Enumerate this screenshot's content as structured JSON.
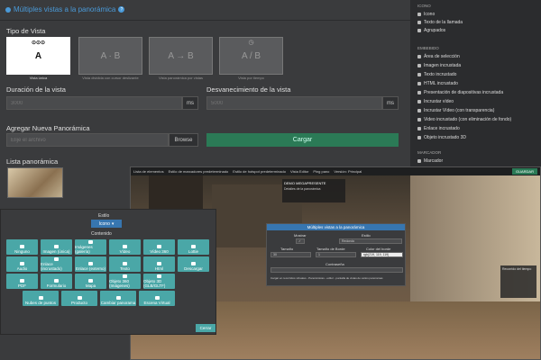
{
  "header": {
    "title": "Múltiples vistas a la panorámica"
  },
  "view_type": {
    "label": "Tipo de Vista",
    "options": [
      {
        "glyph": "A",
        "caption": "Vista única",
        "selected": true
      },
      {
        "glyph": "A · B",
        "caption": "Vista dividida con cursor deslizante",
        "selected": false
      },
      {
        "glyph": "A → B",
        "caption": "Vista panorámica por vistas",
        "selected": false
      },
      {
        "glyph": "A / B",
        "caption": "Vista por tiempo",
        "selected": false
      }
    ]
  },
  "duration": {
    "label": "Duración de la vista",
    "placeholder": "3000",
    "unit": "ms"
  },
  "fade": {
    "label": "Desvanecimiento de la vista",
    "placeholder": "5000",
    "unit": "ms"
  },
  "add_pano": {
    "label": "Agregar Nueva Panorámica",
    "placeholder": "Elije el archivo",
    "browse": "Browse",
    "upload": "Cargar"
  },
  "pano_list": {
    "label": "Lista panorámica"
  },
  "sidebar": {
    "icon_section": "ICONO",
    "icon_items": [
      "Icono",
      "Texto de la llamada",
      "Agrupados"
    ],
    "embed_section": "EMBEBIDO",
    "embed_items": [
      "Área de selección",
      "Imagen incrustada",
      "Texto incrustado",
      "HTML incrustado",
      "Presentación de diapositivas incrustada",
      "Incrustar vídeo",
      "Incrustar Vídeo (con transparencia)",
      "Video incrustado (con eliminación de fondo)",
      "Enlace incrustado",
      "Objeto incrustado 3D"
    ],
    "marker_section": "MARCADOR",
    "marker_items": [
      "Marcador"
    ]
  },
  "popup": {
    "style_label": "Estilo",
    "style_value": "Icono",
    "content_label": "Contenido",
    "tiles": [
      "Ninguno",
      "Imagen (única)",
      "Imágenes (galería)",
      "Vídeo",
      "Vídeo 360",
      "Lottie",
      "Audio",
      "Enlace (incrustado)",
      "Enlace (externo)",
      "Texto",
      "Html",
      "Descargar",
      "PDF",
      "Formulario",
      "Mapa",
      "Objeto 360 (Imágenes)",
      "Objeto 3D (GLB/GLTF)",
      "Nubes de puntos",
      "Producto",
      "Cambiar panorama",
      "Escena Virtual"
    ],
    "close": "Cerrar"
  },
  "viewer": {
    "toolbar": [
      "Lista de elementos",
      "Estilo de marcadores predeterminado",
      "Estilo de hotspot predeterminado",
      "Vista Editor",
      "Ping pano",
      "Versión: Principal"
    ],
    "save": "GUARDAR",
    "overlay_title": "DEMO MEGAPRESENTE",
    "overlay_sub": "Detalles de la panorámica",
    "dialog": {
      "title": "Múltiples vistas a la panorámica",
      "show_label": "Mostrar",
      "style_label": "Estilo",
      "style_value": "Redondo",
      "size_label": "Tamaño",
      "size_value": "30",
      "border_label": "Tamaño de Borde",
      "border_value": "1",
      "color_label": "Color del borde",
      "color_value": "rgb(219, 119, 119)",
      "pass_label": "Contraseña",
      "footer": "Cargar en recorridos virtuales - Panorámicas - editor - pantalla de vistas de varios panoramas"
    },
    "side_panel": "Recorrido del tiempo"
  }
}
